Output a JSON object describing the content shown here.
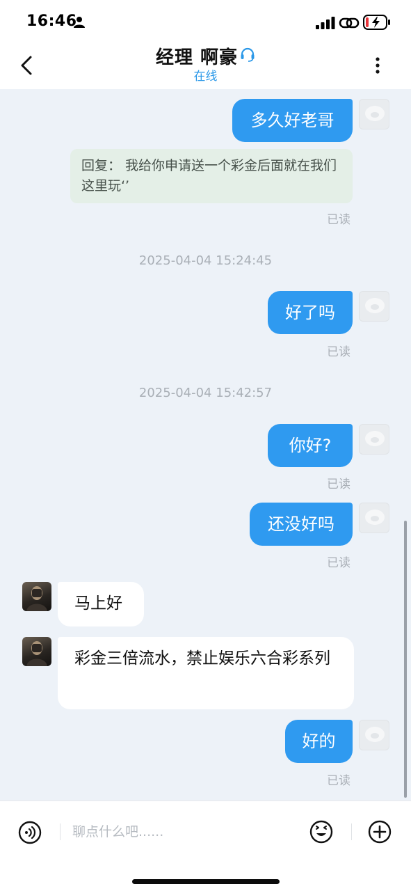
{
  "status_bar": {
    "time": "16:46"
  },
  "header": {
    "title": "经理 啊豪",
    "status": "在线"
  },
  "messages": {
    "m1": {
      "text": "多久好老哥",
      "read": "已读"
    },
    "reply": {
      "text": "回复： 我给你申请送一个彩金后面就在我们这里玩‘’"
    },
    "ts1": "2025-04-04 15:24:45",
    "m2": {
      "text": "好了吗",
      "read": "已读"
    },
    "ts2": "2025-04-04 15:42:57",
    "m3": {
      "text": "你好?",
      "read": "已读"
    },
    "m4": {
      "text": "还没好吗",
      "read": "已读"
    },
    "m5": {
      "text": "马上好"
    },
    "m6": {
      "text": "彩金三倍流水，禁止娱乐六合彩系列"
    },
    "m7": {
      "text": "好的",
      "read": "已读"
    }
  },
  "input": {
    "placeholder": "聊点什么吧......"
  },
  "colors": {
    "accent": "#2f9af0",
    "background": "#edf2f8",
    "reply_quote_bg": "#e4efe7"
  },
  "icons": [
    "person-icon",
    "signal-icon",
    "link-icon",
    "battery-icon",
    "back-icon",
    "headset-icon",
    "more-icon",
    "voice-icon",
    "emoji-icon",
    "plus-icon"
  ]
}
